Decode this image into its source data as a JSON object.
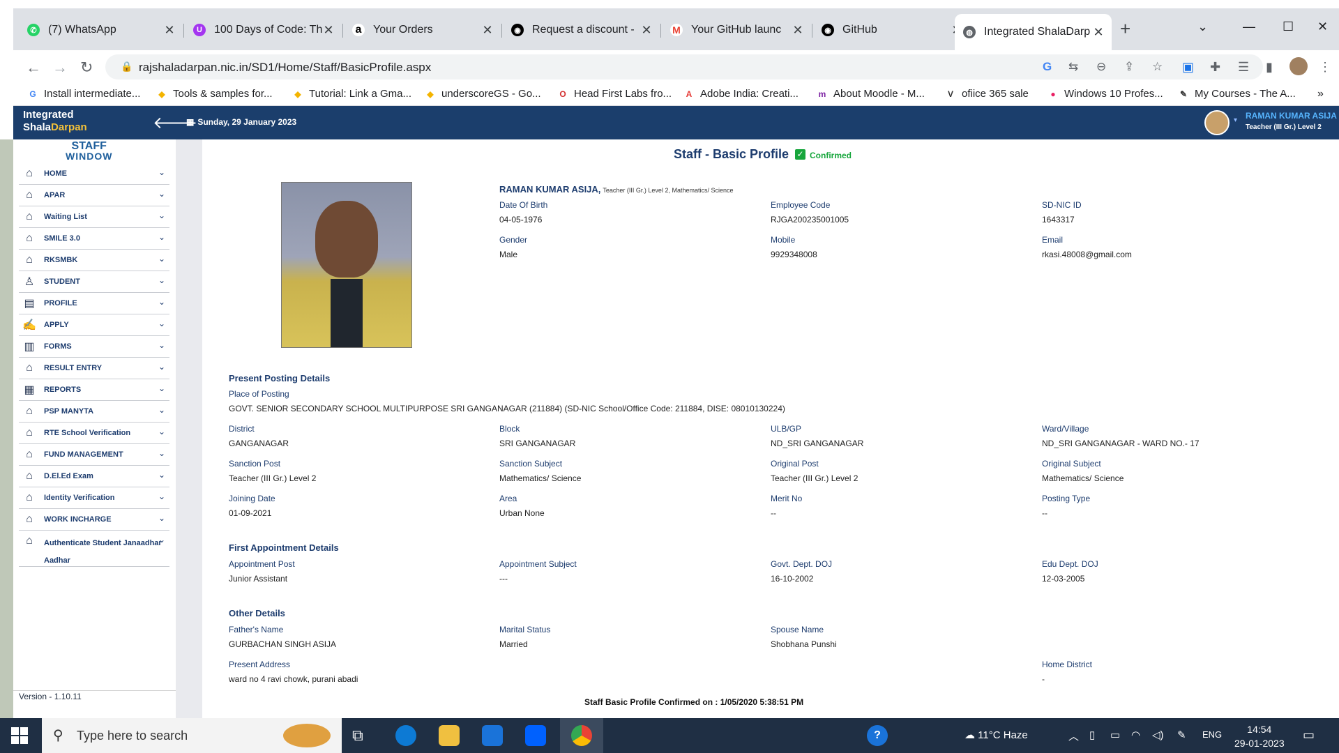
{
  "browser": {
    "tabs": [
      {
        "title": "(7) WhatsApp",
        "icon": "whatsapp-icon",
        "color": "#25d366"
      },
      {
        "title": "100 Days of Code: Th",
        "icon": "udemy-icon",
        "color": "#a435f0"
      },
      {
        "title": "Your Orders",
        "icon": "amazon-icon",
        "color": "#000000"
      },
      {
        "title": "Request a discount - ",
        "icon": "github-icon",
        "color": "#000000"
      },
      {
        "title": "Your GitHub launc",
        "icon": "gmail-icon",
        "color": "#ea4335"
      },
      {
        "title": "GitHub",
        "icon": "github-icon",
        "color": "#000000"
      },
      {
        "title": "Integrated ShalaDarp",
        "icon": "globe-icon",
        "color": "#5f6368"
      }
    ],
    "url": "rajshaladarpan.nic.in/SD1/Home/Staff/BasicProfile.aspx",
    "bookmarks": [
      "Install intermediate...",
      "Tools & samples for...",
      "Tutorial: Link a Gma...",
      "underscoreGS - Go...",
      "Head First Labs fro...",
      "Adobe India: Creati...",
      "About Moodle - M...",
      "ofiice 365 sale",
      "Windows 10 Profes...",
      "My Courses - The A..."
    ]
  },
  "header": {
    "logo_line1": "Integrated",
    "logo_line2a": "Shala",
    "logo_line2b": "Darpan",
    "date": "Sunday, 29 January 2023",
    "user_name": "RAMAN KUMAR ASIJA",
    "user_role": "Teacher (III Gr.) Level 2"
  },
  "sidebar": {
    "brand_line1": "STAFF",
    "brand_line2": "WINDOW",
    "items": [
      {
        "label": "HOME"
      },
      {
        "label": "APAR"
      },
      {
        "label": "Waiting List"
      },
      {
        "label": "SMILE 3.0"
      },
      {
        "label": "RKSMBK"
      },
      {
        "label": "STUDENT"
      },
      {
        "label": "PROFILE"
      },
      {
        "label": "APPLY"
      },
      {
        "label": "FORMS"
      },
      {
        "label": "RESULT ENTRY"
      },
      {
        "label": "REPORTS"
      },
      {
        "label": "PSP MANYTA"
      },
      {
        "label": "RTE School Verification"
      },
      {
        "label": "FUND MANAGEMENT"
      },
      {
        "label": "D.El.Ed Exam"
      },
      {
        "label": "Identity Verification"
      },
      {
        "label": "WORK INCHARGE"
      },
      {
        "label": "Authenticate Student Janaadhar Aadhar"
      }
    ],
    "version": "Version - 1.10.11"
  },
  "profile": {
    "title": "Staff - Basic Profile",
    "status": "Confirmed",
    "name": "RAMAN KUMAR ASIJA,",
    "designation": "Teacher (III Gr.) Level 2, Mathematics/ Science",
    "dob_label": "Date Of Birth",
    "dob": "04-05-1976",
    "emp_code_label": "Employee Code",
    "emp_code": "RJGA200235001005",
    "sdnic_label": "SD-NIC ID",
    "sdnic": "1643317",
    "gender_label": "Gender",
    "gender": "Male",
    "mobile_label": "Mobile",
    "mobile": "9929348008",
    "email_label": "Email",
    "email": "rkasi.48008@gmail.com"
  },
  "posting": {
    "section": "Present Posting Details",
    "place_label": "Place of Posting",
    "place": "GOVT. SENIOR SECONDARY SCHOOL MULTIPURPOSE SRI GANGANAGAR (211884) (SD-NIC School/Office Code: 211884, DISE: 08010130224)",
    "district_label": "District",
    "district": "GANGANAGAR",
    "block_label": "Block",
    "block": "SRI GANGANAGAR",
    "ulb_label": "ULB/GP",
    "ulb": "ND_SRI GANGANAGAR",
    "ward_label": "Ward/Village",
    "ward": "ND_SRI GANGANAGAR - WARD NO.- 17",
    "sanction_post_label": "Sanction Post",
    "sanction_post": "Teacher (III Gr.) Level 2",
    "sanction_subject_label": "Sanction Subject",
    "sanction_subject": "Mathematics/ Science",
    "original_post_label": "Original Post",
    "original_post": "Teacher (III Gr.) Level 2",
    "original_subject_label": "Original Subject",
    "original_subject": "Mathematics/ Science",
    "joining_label": "Joining Date",
    "joining": "01-09-2021",
    "area_label": "Area",
    "area": "Urban None",
    "merit_label": "Merit No",
    "merit": "--",
    "posting_type_label": "Posting Type",
    "posting_type": "--"
  },
  "appointment": {
    "section": "First Appointment Details",
    "post_label": "Appointment Post",
    "post": "Junior Assistant",
    "subject_label": "Appointment Subject",
    "subject": "---",
    "govt_doj_label": "Govt. Dept. DOJ",
    "govt_doj": "16-10-2002",
    "edu_doj_label": "Edu Dept. DOJ",
    "edu_doj": "12-03-2005"
  },
  "other": {
    "section": "Other Details",
    "father_label": "Father's Name",
    "father": "GURBACHAN SINGH ASIJA",
    "marital_label": "Marital Status",
    "marital": "Married",
    "spouse_label": "Spouse Name",
    "spouse": "Shobhana Punshi",
    "address_label": "Present Address",
    "address": "ward no 4 ravi chowk, purani abadi",
    "home_district_label": "Home District",
    "home_district": "-"
  },
  "footer_note": "Staff Basic Profile Confirmed on : 1/05/2020 5:38:51 PM",
  "taskbar": {
    "search_placeholder": "Type here to search",
    "weather": "11°C  Haze",
    "lang": "ENG",
    "time": "14:54",
    "date": "29-01-2023"
  }
}
